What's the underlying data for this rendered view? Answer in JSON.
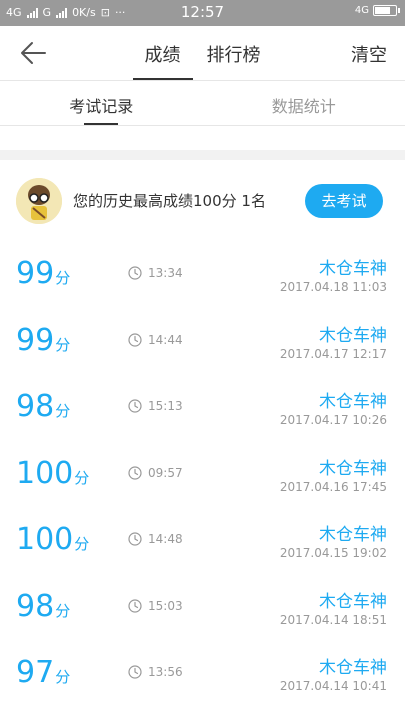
{
  "status_bar": {
    "left_text": "4G",
    "left_text_2": "G",
    "speed": "0K/s",
    "time": "12:57",
    "right_text": "4G"
  },
  "header": {
    "back_icon": "back-arrow-icon",
    "tabs": [
      {
        "label": "成绩",
        "active": true
      },
      {
        "label": "排行榜",
        "active": false
      }
    ],
    "clear_label": "清空"
  },
  "subtabs": [
    {
      "label": "考试记录",
      "active": true
    },
    {
      "label": "数据统计",
      "active": false
    }
  ],
  "best": {
    "text": "您的历史最高成绩100分  1名",
    "button_label": "去考试"
  },
  "records": [
    {
      "score": "99",
      "unit": "分",
      "duration": "13:34",
      "name": "木仓车神",
      "date": "2017.04.18  11:03"
    },
    {
      "score": "99",
      "unit": "分",
      "duration": "14:44",
      "name": "木仓车神",
      "date": "2017.04.17  12:17"
    },
    {
      "score": "98",
      "unit": "分",
      "duration": "15:13",
      "name": "木仓车神",
      "date": "2017.04.17  10:26"
    },
    {
      "score": "100",
      "unit": "分",
      "duration": "09:57",
      "name": "木仓车神",
      "date": "2017.04.16  17:45"
    },
    {
      "score": "100",
      "unit": "分",
      "duration": "14:48",
      "name": "木仓车神",
      "date": "2017.04.15  19:02"
    },
    {
      "score": "98",
      "unit": "分",
      "duration": "15:03",
      "name": "木仓车神",
      "date": "2017.04.14  18:51"
    },
    {
      "score": "97",
      "unit": "分",
      "duration": "13:56",
      "name": "木仓车神",
      "date": "2017.04.14  10:41"
    }
  ],
  "colors": {
    "accent": "#1eaaf1",
    "status_bar": "#9a9a9a"
  }
}
